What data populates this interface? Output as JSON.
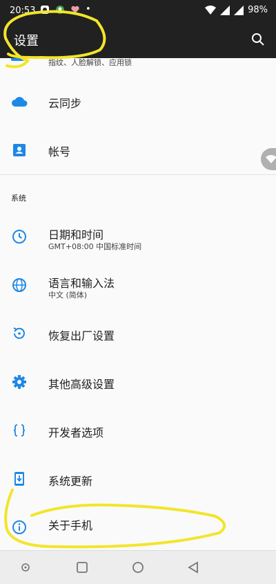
{
  "status_bar": {
    "time": "20:53",
    "battery": "98%"
  },
  "app_bar": {
    "title": "设置",
    "search_icon": "search-icon"
  },
  "partial_row": {
    "subtitle": "指纹、人脸解锁、应用锁"
  },
  "rows_top": [
    {
      "label": "云同步",
      "icon": "cloud-icon"
    },
    {
      "label": "帐号",
      "icon": "account-icon"
    }
  ],
  "section": {
    "label": "系统"
  },
  "rows_system": [
    {
      "label": "日期和时间",
      "subtitle": "GMT+08:00 中国标准时间",
      "icon": "clock-icon"
    },
    {
      "label": "语言和输入法",
      "subtitle": "中文 (简体)",
      "icon": "globe-icon"
    },
    {
      "label": "恢复出厂设置",
      "icon": "restore-icon"
    },
    {
      "label": "其他高级设置",
      "icon": "gear-icon"
    },
    {
      "label": "开发者选项",
      "icon": "braces-icon"
    },
    {
      "label": "系统更新",
      "icon": "system-update-icon"
    },
    {
      "label": "关于手机",
      "icon": "info-icon"
    }
  ],
  "colors": {
    "accent": "#1e88e5",
    "bar": "#212121",
    "annotation": "#f2e52a"
  }
}
